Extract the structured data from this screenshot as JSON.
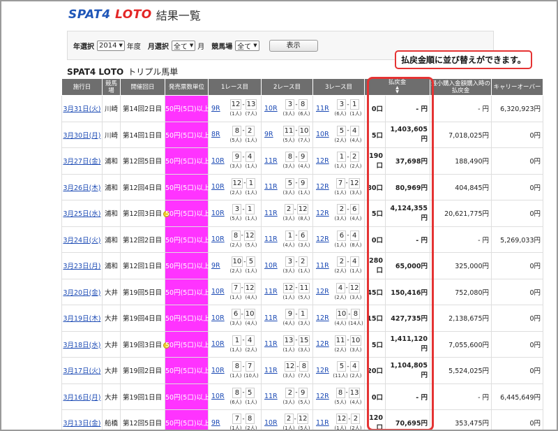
{
  "brand": {
    "logo_a": "SPAT4",
    "logo_b": "LOTO",
    "title": "結果一覧"
  },
  "filter": {
    "year_label": "年選択",
    "year_value": "2014",
    "year_unit": "年度",
    "month_label": "月選択",
    "month_value": "全て",
    "month_unit": "月",
    "venue_label": "競馬場",
    "venue_value": "全て",
    "show_button": "表示"
  },
  "section": {
    "title": "SPAT4 LOTO",
    "subtitle": "トリプル馬単"
  },
  "callout": "払戻金順に並び替えができます。",
  "colors": {
    "accent": "#ff33ff",
    "highlight": "#e53333",
    "header": "#6e6e6e",
    "link": "#1a49b4"
  },
  "table": {
    "headers": [
      "施行日",
      "競馬場",
      "開催回日",
      "発売票数単位",
      "1レース目",
      "2レース目",
      "3レース目",
      "払戻金",
      "最小購入金額購入時の払戻金",
      "キャリーオーバー"
    ],
    "rows": [
      {
        "date": "3月31日(火)",
        "venue": "川崎",
        "held": "第14回2日目",
        "star": false,
        "unit": "50円(5口)以上",
        "r1": {
          "race": "9R",
          "a": "12",
          "b": "13",
          "pa": "(1人)",
          "pb": "(7人)"
        },
        "r2": {
          "race": "10R",
          "a": "3",
          "b": "8",
          "pa": "(3人)",
          "pb": "(6人)"
        },
        "r3": {
          "race": "11R",
          "a": "3",
          "b": "1",
          "pa": "(6人)",
          "pb": "(1人)"
        },
        "count": "0口",
        "payout": "- 円",
        "minpay": "- 円",
        "carry": "6,320,923円"
      },
      {
        "date": "3月30日(月)",
        "venue": "川崎",
        "held": "第14回1日目",
        "star": false,
        "unit": "50円(5口)以上",
        "r1": {
          "race": "8R",
          "a": "8",
          "b": "2",
          "pa": "(5人)",
          "pb": "(1人)"
        },
        "r2": {
          "race": "9R",
          "a": "11",
          "b": "10",
          "pa": "(5人)",
          "pb": "(7人)"
        },
        "r3": {
          "race": "10R",
          "a": "5",
          "b": "4",
          "pa": "(2人)",
          "pb": "(4人)"
        },
        "count": "5口",
        "payout": "1,403,605円",
        "minpay": "7,018,025円",
        "carry": "0円"
      },
      {
        "date": "3月27日(金)",
        "venue": "浦和",
        "held": "第12回5日目",
        "star": false,
        "unit": "50円(5口)以上",
        "r1": {
          "race": "10R",
          "a": "9",
          "b": "4",
          "pa": "(3人)",
          "pb": "(1人)"
        },
        "r2": {
          "race": "11R",
          "a": "8",
          "b": "9",
          "pa": "(3人)",
          "pb": "(4人)"
        },
        "r3": {
          "race": "12R",
          "a": "1",
          "b": "2",
          "pa": "(1人)",
          "pb": "(2人)"
        },
        "count": "190口",
        "payout": "37,698円",
        "minpay": "188,490円",
        "carry": "0円"
      },
      {
        "date": "3月26日(木)",
        "venue": "浦和",
        "held": "第12回4日目",
        "star": false,
        "unit": "50円(5口)以上",
        "r1": {
          "race": "10R",
          "a": "12",
          "b": "1",
          "pa": "(2人)",
          "pb": "(1人)"
        },
        "r2": {
          "race": "11R",
          "a": "5",
          "b": "9",
          "pa": "(3人)",
          "pb": "(1人)"
        },
        "r3": {
          "race": "12R",
          "a": "7",
          "b": "12",
          "pa": "(1人)",
          "pb": "(3人)"
        },
        "count": "80口",
        "payout": "80,969円",
        "minpay": "404,845円",
        "carry": "0円"
      },
      {
        "date": "3月25日(水)",
        "venue": "浦和",
        "held": "第12回3日目",
        "star": true,
        "unit": "50円(5口)以上",
        "r1": {
          "race": "10R",
          "a": "3",
          "b": "1",
          "pa": "(5人)",
          "pb": "(1人)"
        },
        "r2": {
          "race": "11R",
          "a": "2",
          "b": "12",
          "pa": "(3人)",
          "pb": "(8人)"
        },
        "r3": {
          "race": "12R",
          "a": "2",
          "b": "6",
          "pa": "(3人)",
          "pb": "(4人)"
        },
        "count": "5口",
        "payout": "4,124,355円",
        "minpay": "20,621,775円",
        "carry": "0円"
      },
      {
        "date": "3月24日(火)",
        "venue": "浦和",
        "held": "第12回2日目",
        "star": false,
        "unit": "50円(5口)以上",
        "r1": {
          "race": "10R",
          "a": "8",
          "b": "12",
          "pa": "(2人)",
          "pb": "(5人)"
        },
        "r2": {
          "race": "11R",
          "a": "1",
          "b": "6",
          "pa": "(4人)",
          "pb": "(3人)"
        },
        "r3": {
          "race": "12R",
          "a": "6",
          "b": "4",
          "pa": "(1人)",
          "pb": "(8人)"
        },
        "count": "0口",
        "payout": "- 円",
        "minpay": "- 円",
        "carry": "5,269,033円"
      },
      {
        "date": "3月23日(月)",
        "venue": "浦和",
        "held": "第12回1日目",
        "star": false,
        "unit": "50円(5口)以上",
        "r1": {
          "race": "9R",
          "a": "10",
          "b": "5",
          "pa": "(2人)",
          "pb": "(1人)"
        },
        "r2": {
          "race": "10R",
          "a": "3",
          "b": "2",
          "pa": "(3人)",
          "pb": "(1人)"
        },
        "r3": {
          "race": "11R",
          "a": "2",
          "b": "4",
          "pa": "(2人)",
          "pb": "(1人)"
        },
        "count": "280口",
        "payout": "65,000円",
        "minpay": "325,000円",
        "carry": "0円"
      },
      {
        "date": "3月20日(金)",
        "venue": "大井",
        "held": "第19回5日目",
        "star": false,
        "unit": "50円(5口)以上",
        "r1": {
          "race": "10R",
          "a": "7",
          "b": "12",
          "pa": "(1人)",
          "pb": "(4人)"
        },
        "r2": {
          "race": "11R",
          "a": "12",
          "b": "11",
          "pa": "(1人)",
          "pb": "(5人)"
        },
        "r3": {
          "race": "12R",
          "a": "4",
          "b": "12",
          "pa": "(2人)",
          "pb": "(3人)"
        },
        "count": "45口",
        "payout": "150,416円",
        "minpay": "752,080円",
        "carry": "0円"
      },
      {
        "date": "3月19日(木)",
        "venue": "大井",
        "held": "第19回4日目",
        "star": false,
        "unit": "50円(5口)以上",
        "r1": {
          "race": "10R",
          "a": "6",
          "b": "10",
          "pa": "(3人)",
          "pb": "(4人)"
        },
        "r2": {
          "race": "11R",
          "a": "9",
          "b": "1",
          "pa": "(4人)",
          "pb": "(3人)"
        },
        "r3": {
          "race": "12R",
          "a": "10",
          "b": "8",
          "pa": "(4人)",
          "pb": "(14人)"
        },
        "count": "15口",
        "payout": "427,735円",
        "minpay": "2,138,675円",
        "carry": "0円"
      },
      {
        "date": "3月18日(水)",
        "venue": "大井",
        "held": "第19回3日目",
        "star": true,
        "unit": "50円(5口)以上",
        "r1": {
          "race": "10R",
          "a": "1",
          "b": "4",
          "pa": "(1人)",
          "pb": "(2人)"
        },
        "r2": {
          "race": "11R",
          "a": "13",
          "b": "15",
          "pa": "(1人)",
          "pb": "(3人)"
        },
        "r3": {
          "race": "12R",
          "a": "11",
          "b": "10",
          "pa": "(2人)",
          "pb": "(3人)"
        },
        "count": "5口",
        "payout": "1,411,120円",
        "minpay": "7,055,600円",
        "carry": "0円"
      },
      {
        "date": "3月17日(火)",
        "venue": "大井",
        "held": "第19回2日目",
        "star": false,
        "unit": "50円(5口)以上",
        "r1": {
          "race": "10R",
          "a": "8",
          "b": "7",
          "pa": "(1人)",
          "pb": "(10人)"
        },
        "r2": {
          "race": "11R",
          "a": "12",
          "b": "8",
          "pa": "(3人)",
          "pb": "(7人)"
        },
        "r3": {
          "race": "12R",
          "a": "5",
          "b": "4",
          "pa": "(11人)",
          "pb": "(2人)"
        },
        "count": "20口",
        "payout": "1,104,805円",
        "minpay": "5,524,025円",
        "carry": "0円"
      },
      {
        "date": "3月16日(月)",
        "venue": "大井",
        "held": "第19回1日目",
        "star": false,
        "unit": "50円(5口)以上",
        "r1": {
          "race": "10R",
          "a": "8",
          "b": "5",
          "pa": "(6人)",
          "pb": "(1人)"
        },
        "r2": {
          "race": "11R",
          "a": "2",
          "b": "9",
          "pa": "(3人)",
          "pb": "(5人)"
        },
        "r3": {
          "race": "12R",
          "a": "8",
          "b": "13",
          "pa": "(5人)",
          "pb": "(4人)"
        },
        "count": "0口",
        "payout": "- 円",
        "minpay": "- 円",
        "carry": "6,445,649円"
      },
      {
        "date": "3月13日(金)",
        "venue": "船橋",
        "held": "第12回5日目",
        "star": false,
        "unit": "50円(5口)以上",
        "r1": {
          "race": "9R",
          "a": "7",
          "b": "8",
          "pa": "(1人)",
          "pb": "(2人)"
        },
        "r2": {
          "race": "10R",
          "a": "2",
          "b": "12",
          "pa": "(1人)",
          "pb": "(5人)"
        },
        "r3": {
          "race": "11R",
          "a": "12",
          "b": "2",
          "pa": "(1人)",
          "pb": "(2人)"
        },
        "count": "120口",
        "payout": "70,695円",
        "minpay": "353,475円",
        "carry": "0円"
      }
    ]
  }
}
